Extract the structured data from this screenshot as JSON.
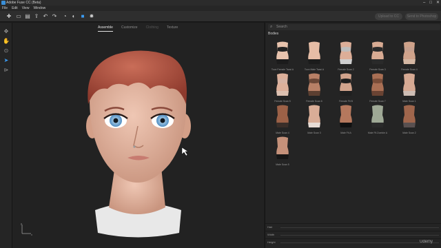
{
  "window": {
    "title": "Adobe Fuse CC (Beta)",
    "controls": [
      "–",
      "□",
      "✕"
    ]
  },
  "menu": [
    "File",
    "Edit",
    "View",
    "Window"
  ],
  "toolbar": {
    "icons": [
      "add-icon",
      "open-icon",
      "save-icon",
      "export-icon",
      "undo-icon",
      "redo-icon",
      "reset-icon",
      "camera-icon",
      "lighting-icon",
      "settings-icon"
    ],
    "buttons": [
      "Upload to CC",
      "Send to Photoshop"
    ]
  },
  "left_tools": [
    "rotate-icon",
    "pan-icon",
    "zoom-icon",
    "select-icon",
    "camera-tool-icon"
  ],
  "viewport": {
    "tabs": [
      {
        "label": "Assemble",
        "state": "active"
      },
      {
        "label": "Customize",
        "state": "normal"
      },
      {
        "label": "Clothing",
        "state": "disabled"
      },
      {
        "label": "Texture",
        "state": "normal"
      }
    ],
    "axis": {
      "x": "x",
      "y": "y"
    }
  },
  "panel": {
    "search_placeholder": "Search",
    "section": "Bodies",
    "items": [
      {
        "label": "Toon Female Tsasi A",
        "skin": "#e8c3ad",
        "top": "#222222",
        "bottom": "#1c1c1c"
      },
      {
        "label": "Toon Male Tsasi A",
        "skin": "#e6bda6",
        "top": null,
        "bottom": "#1c1c1c"
      },
      {
        "label": "Female Scan 2",
        "skin": "#dcae98",
        "top": "#bdbdbd",
        "bottom": "#cfcfcf"
      },
      {
        "label": "Female Scan 3",
        "skin": "#d8ab93",
        "top": "#2a2a2a",
        "bottom": "#2a2a2a"
      },
      {
        "label": "Female Scan 4",
        "skin": "#cfa28a",
        "top": "#c7a08e",
        "bottom": "#d4b7a3"
      },
      {
        "label": "Female Scan 5",
        "skin": "#ddb09a",
        "top": "#d7b3a3",
        "bottom": "#ddc1b1"
      },
      {
        "label": "Female Scan 6",
        "skin": "#b88066",
        "top": "#6a4737",
        "bottom": "#5c3f31"
      },
      {
        "label": "Female Fit B",
        "skin": "#d1a38c",
        "top": "#1f1f1f",
        "bottom": "#1f1f1f"
      },
      {
        "label": "Female Scan 7",
        "skin": "#a96f54",
        "top": "#7a4d39",
        "bottom": "#6a4333"
      },
      {
        "label": "Male Scan 1",
        "skin": "#d6a993",
        "top": null,
        "bottom": "#cdbdb4"
      },
      {
        "label": "Male Scan 4",
        "skin": "#9c6147",
        "top": null,
        "bottom": "#3a2e29"
      },
      {
        "label": "Male Scan 3",
        "skin": "#d9ad97",
        "top": null,
        "bottom": "#e7dcd5"
      },
      {
        "label": "Male Fit A",
        "skin": "#b5785d",
        "top": null,
        "bottom": "#111111"
      },
      {
        "label": "Male Fit Zombie A",
        "skin": "#9fa996",
        "top": null,
        "bottom": "#2a2a2a"
      },
      {
        "label": "Male Scan 2",
        "skin": "#a0664c",
        "top": null,
        "bottom": "#595050"
      },
      {
        "label": "Male Scan 5",
        "skin": "#c5917a",
        "top": null,
        "bottom": "#161616"
      }
    ],
    "bottom_rows": [
      "Hair",
      "Width",
      "Height"
    ]
  },
  "watermark": "Udemy"
}
